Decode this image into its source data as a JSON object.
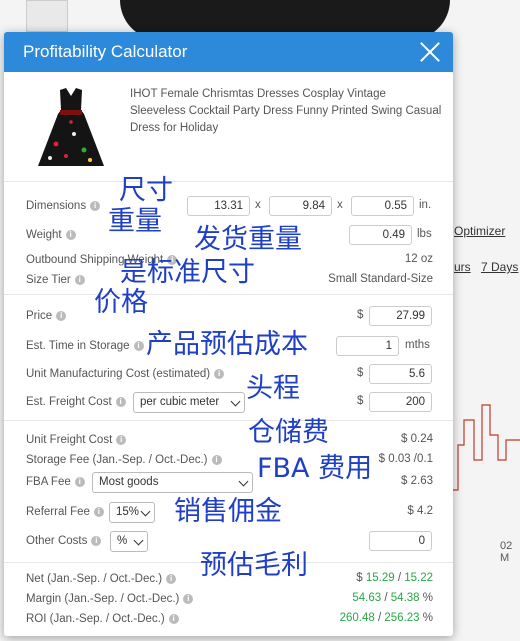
{
  "background": {
    "links": [
      "Optimizer",
      "urs",
      "7 Days"
    ],
    "axis_label": "02 M"
  },
  "modal": {
    "title": "Profitability Calculator",
    "product_title": "IHOT Female Chrismtas Dresses Cosplay Vintage Sleeveless Cocktail Party Dress Funny Printed Swing Casual Dress for Holiday"
  },
  "fields": {
    "dimensions": {
      "label": "Dimensions",
      "l": "13.31",
      "w": "9.84",
      "h": "0.55",
      "sep": "x",
      "unit": "in."
    },
    "weight": {
      "label": "Weight",
      "value": "0.49",
      "unit": "lbs"
    },
    "outbound_weight": {
      "label": "Outbound Shipping Weight",
      "value": "12 oz"
    },
    "size_tier": {
      "label": "Size Tier",
      "value": "Small Standard-Size"
    },
    "price": {
      "label": "Price",
      "currency": "$",
      "value": "27.99"
    },
    "storage_time": {
      "label": "Est. Time in Storage",
      "value": "1",
      "unit": "mths"
    },
    "manufacturing_cost": {
      "label": "Unit Manufacturing Cost (estimated)",
      "currency": "$",
      "value": "5.6"
    },
    "freight_cost": {
      "label": "Est. Freight Cost",
      "select": "per cubic meter",
      "currency": "$",
      "value": "200"
    },
    "unit_freight_cost": {
      "label": "Unit Freight Cost",
      "value": "$ 0.24"
    },
    "storage_fee": {
      "label": "Storage Fee (Jan.-Sep. / Oct.-Dec.)",
      "value": "$ 0.03 /0.1"
    },
    "fba_fee": {
      "label": "FBA Fee",
      "select": "Most goods",
      "value": "$ 2.63"
    },
    "referral_fee": {
      "label": "Referral Fee",
      "select": "15%",
      "value": "$ 4.2"
    },
    "other_costs": {
      "label": "Other Costs",
      "select": "%",
      "value": "0"
    }
  },
  "results": {
    "net": {
      "label": "Net (Jan.-Sep. / Oct.-Dec.)",
      "prefix": "$",
      "v1": "15.29",
      "sep": "/",
      "v2": "15.22"
    },
    "margin": {
      "label": "Margin (Jan.-Sep. / Oct.-Dec.)",
      "v1": "54.63",
      "sep": "/",
      "v2": "54.38",
      "suffix": "%"
    },
    "roi": {
      "label": "ROI (Jan.-Sep. / Oct.-Dec.)",
      "v1": "260.48",
      "sep": "/",
      "v2": "256.23",
      "suffix": "%"
    }
  },
  "annotations": {
    "dimensions": "尺寸",
    "weight": "重量",
    "outbound_weight": "发货重量",
    "size_tier": "是标准尺寸",
    "price": "价格",
    "product_cost": "产品预估成本",
    "freight": "头程",
    "storage": "仓储费",
    "fba": "FBA 费用",
    "referral": "销售佣金",
    "profit": "预估毛利"
  },
  "colors": {
    "header": "#2d89d9",
    "annotation": "#1f3fc4",
    "positive": "#29a745"
  }
}
